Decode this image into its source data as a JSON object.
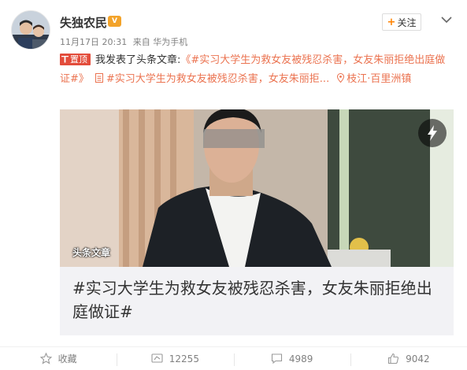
{
  "user": {
    "name": "失独农民",
    "badge": "V"
  },
  "meta": {
    "timestamp": "11月17日 20:31",
    "source": "来自 华为手机"
  },
  "follow_label": "关注",
  "post": {
    "top_badge": "置顶",
    "text_prefix": "我发表了头条文章:",
    "article_link": "《#实习大学生为救女友被残忍杀害，女友朱丽拒绝出庭做证#》",
    "doc_link": "#实习大学生为救女友被残忍杀害，女友朱丽拒...",
    "location": "枝江·百里洲镇"
  },
  "article": {
    "watermark": "头条文章",
    "title": "#实习大学生为救女友被残忍杀害，女友朱丽拒绝出庭做证#"
  },
  "actions": {
    "favorite": "收藏",
    "repost_count": "12255",
    "comment_count": "4989",
    "like_count": "9042"
  },
  "colors": {
    "link": "#eb7350",
    "top_badge": "#e34c3b",
    "follow_plus": "#ff8200"
  }
}
